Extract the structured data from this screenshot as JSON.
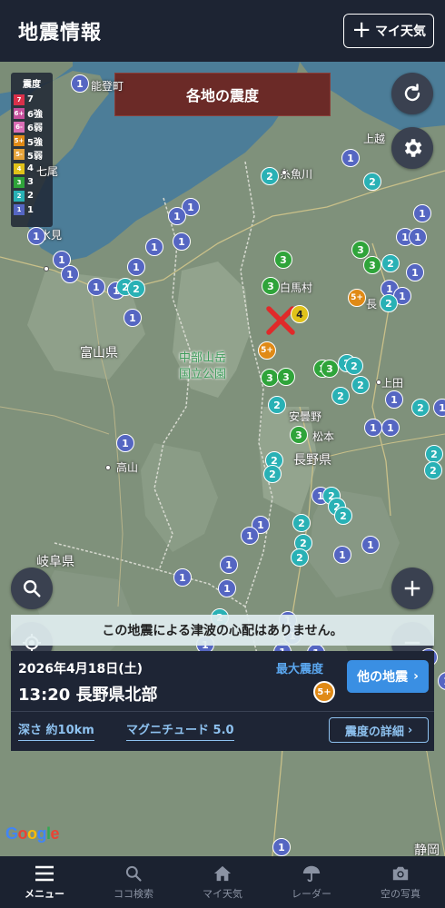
{
  "header": {
    "title": "地震情報",
    "my_weather_label": "マイ天気"
  },
  "map": {
    "title": "各地の震度",
    "legend": {
      "title": "震度",
      "items": [
        {
          "code": "7",
          "label": "7",
          "color": "#d9304a"
        },
        {
          "code": "6+",
          "label": "6強",
          "color": "#c64f9c"
        },
        {
          "code": "6-",
          "label": "6弱",
          "color": "#d96eb5"
        },
        {
          "code": "5+",
          "label": "5強",
          "color": "#e08a16"
        },
        {
          "code": "5-",
          "label": "5弱",
          "color": "#e6a33a"
        },
        {
          "code": "4",
          "label": "4",
          "color": "#e0c21a"
        },
        {
          "code": "3",
          "label": "3",
          "color": "#2fa43a"
        },
        {
          "code": "2",
          "label": "2",
          "color": "#29b1b5"
        },
        {
          "code": "1",
          "label": "1",
          "color": "#5566c2"
        }
      ]
    },
    "places": {
      "noto": "能登町",
      "toyama_pref": "富山県",
      "park1": "中部山岳",
      "park2": "国立公園",
      "itoigawa": "糸魚川",
      "hakuba": "白馬村",
      "azumino": "安曇野",
      "matsumoto": "松本",
      "nagano_pref": "長野県",
      "takayama": "高山",
      "gifu_pref": "岐阜県",
      "ueda": "上田",
      "jouetsu": "上越",
      "nagano": "長",
      "himi": "氷見",
      "nanao": "七尾",
      "shizuoka": "静岡"
    },
    "epicenter_label": "×"
  },
  "tsunami_message": "この地震による津波の心配はありません。",
  "quake": {
    "date": "2026年4月18日(土)",
    "time_place": "13:20 長野県北部",
    "max_label": "最大震度",
    "max_value": "5+",
    "other_button": "他の地震",
    "depth": "深さ 約10km",
    "magnitude": "マグニチュード 5.0",
    "detail_button": "震度の詳細"
  },
  "attribution": "Google",
  "nav": [
    {
      "label": "メニュー",
      "icon": "menu-icon",
      "active": true
    },
    {
      "label": "ココ検索",
      "icon": "search-icon",
      "active": false
    },
    {
      "label": "マイ天気",
      "icon": "home-icon",
      "active": false
    },
    {
      "label": "レーダー",
      "icon": "umbrella-icon",
      "active": false
    },
    {
      "label": "空の写真",
      "icon": "camera-icon",
      "active": false
    }
  ]
}
